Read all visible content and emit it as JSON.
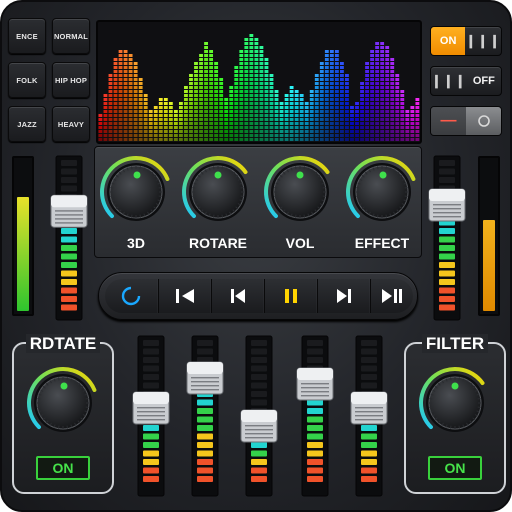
{
  "presets": [
    {
      "label": "ENCE"
    },
    {
      "label": "NORMAL"
    },
    {
      "label": "FOLK"
    },
    {
      "label": "HIP HOP"
    },
    {
      "label": "JAZZ"
    },
    {
      "label": "HEAVY"
    }
  ],
  "toggles": {
    "power_on_label": "ON",
    "power_off_label": "OFF"
  },
  "knobs": [
    {
      "label": "3D",
      "level": 0.55
    },
    {
      "label": "ROTARE",
      "level": 0.5
    },
    {
      "label": "VOL",
      "level": 0.5
    },
    {
      "label": "EFFECT",
      "level": 0.55
    }
  ],
  "left_meter_level": 0.75,
  "right_meter_level": 0.6,
  "left_slider_level": 0.7,
  "right_slider_level": 0.75,
  "eq_bands": [
    {
      "level": 0.55
    },
    {
      "level": 0.8
    },
    {
      "level": 0.4
    },
    {
      "level": 0.75
    },
    {
      "level": 0.55
    }
  ],
  "rotate_panel": {
    "title": "RDTATE",
    "button_label": "ON"
  },
  "filter_panel": {
    "title": "FILTER",
    "button_label": "ON"
  },
  "colors": {
    "accent_orange": "#f5a000",
    "on_green": "#46e34a",
    "knob_indicator": "#3fe04c",
    "arc_start": "#1ec8ff",
    "arc_end": "#ffd400"
  }
}
